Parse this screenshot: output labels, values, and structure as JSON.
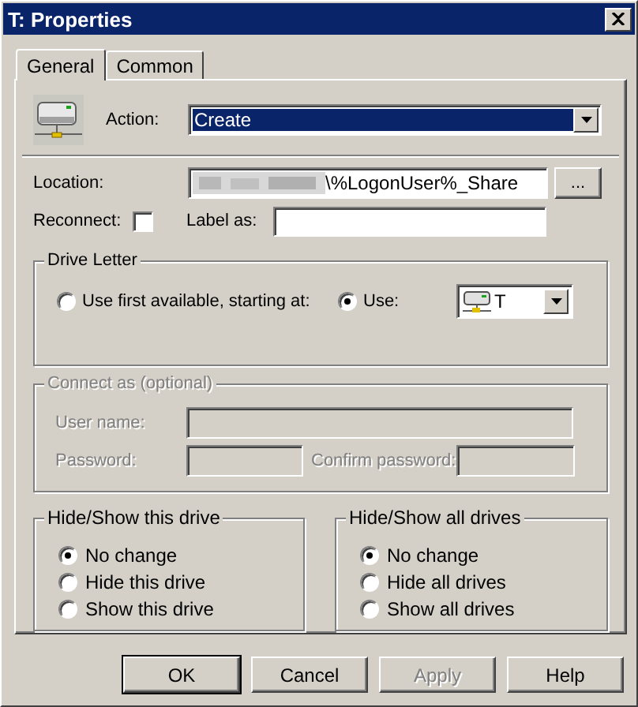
{
  "window": {
    "title": "T: Properties"
  },
  "tabs": [
    {
      "label": "General",
      "selected": true
    },
    {
      "label": "Common",
      "selected": false
    }
  ],
  "action": {
    "label": "Action:",
    "value": "Create"
  },
  "location": {
    "label": "Location:",
    "value": "\\%LogonUser%_Share",
    "browse": "..."
  },
  "reconnect": {
    "label": "Reconnect:",
    "checked": false
  },
  "label_as": {
    "label": "Label as:"
  },
  "drive_letter": {
    "title": "Drive Letter",
    "options": [
      {
        "label": "Use first available, starting at:",
        "selected": false
      },
      {
        "label": "Use:",
        "selected": true
      }
    ],
    "drive": "T"
  },
  "connect_as": {
    "title": "Connect as (optional)",
    "disabled": true,
    "user_name": "User name:",
    "password": "Password:",
    "confirm_password": "Confirm password:"
  },
  "hide_show_this_drive": {
    "title": "Hide/Show this drive",
    "options": [
      {
        "label": "No change",
        "selected": true
      },
      {
        "label": "Hide this drive",
        "selected": false
      },
      {
        "label": "Show this drive",
        "selected": false
      }
    ]
  },
  "hide_show_all_drives": {
    "title": "Hide/Show all drives",
    "options": [
      {
        "label": "No change",
        "selected": true
      },
      {
        "label": "Hide all drives",
        "selected": false
      },
      {
        "label": "Show all drives",
        "selected": false
      }
    ]
  },
  "buttons": [
    {
      "label": "OK",
      "default": true,
      "disabled": false
    },
    {
      "label": "Cancel",
      "default": false,
      "disabled": false
    },
    {
      "label": "Apply",
      "default": false,
      "disabled": true
    },
    {
      "label": "Help",
      "default": false,
      "disabled": false
    }
  ]
}
